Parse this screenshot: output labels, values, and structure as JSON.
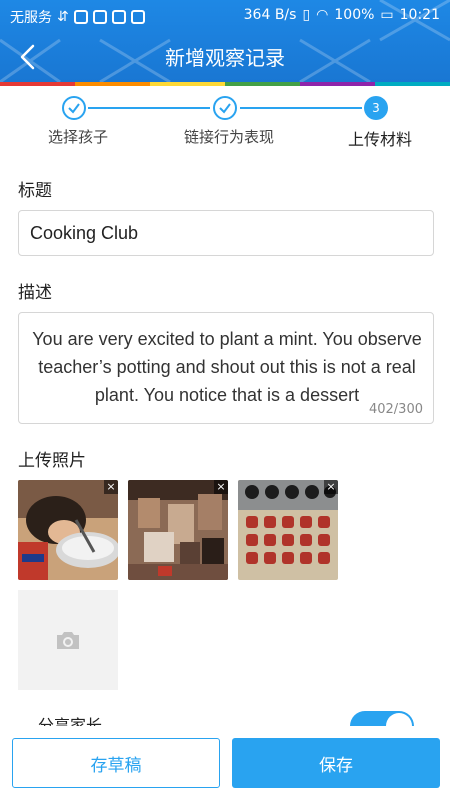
{
  "status_bar": {
    "carrier": "无服务",
    "speed": "364 B/s",
    "battery": "100%",
    "time": "10:21"
  },
  "header": {
    "title": "新增观察记录",
    "back_icon": "chevron-left-icon"
  },
  "stepper": {
    "steps": [
      {
        "label": "选择孩子",
        "state": "done"
      },
      {
        "label": "链接行为表现",
        "state": "done"
      },
      {
        "label": "上传材料",
        "state": "active",
        "number": "3"
      }
    ]
  },
  "form": {
    "title_label": "标题",
    "title_value": "Cooking Club",
    "description_label": "描述",
    "description_value": "You are very excited to plant a mint. You observe teacher’s potting and shout out this is not a real plant. You notice that is a dessert",
    "description_counter": "402/300",
    "photos_label": "上传照片",
    "photos": [
      {
        "name": "child-mixing-bowl"
      },
      {
        "name": "blurred-children-table"
      },
      {
        "name": "cups-on-tray"
      }
    ],
    "add_photo_icon": "camera-icon",
    "toggle_label": "分享家长",
    "toggle_on": true
  },
  "actions": {
    "draft_label": "存草稿",
    "save_label": "保存"
  },
  "colors": {
    "accent": "#29a3f0",
    "header": "#1976d2"
  }
}
